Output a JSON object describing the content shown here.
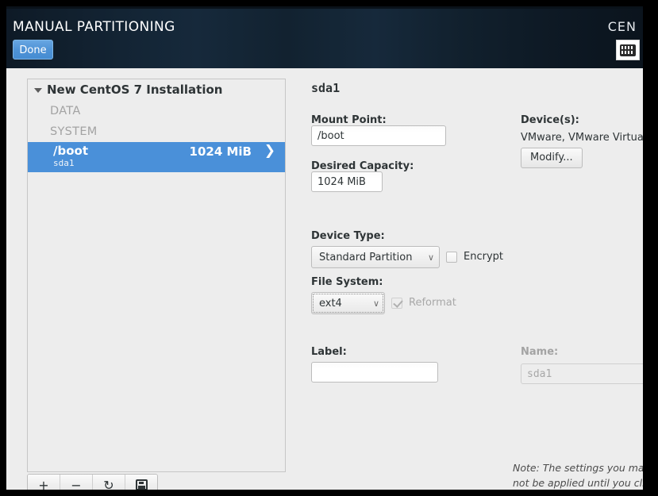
{
  "header": {
    "title": "MANUAL PARTITIONING",
    "done_label": "Done",
    "brand": "CEN",
    "keyboard_icon": "keyboard-icon"
  },
  "sidebar": {
    "group_title": "New CentOS 7 Installation",
    "sections": [
      {
        "label": "DATA"
      },
      {
        "label": "SYSTEM"
      }
    ],
    "rows": [
      {
        "mount": "/boot",
        "device": "sda1",
        "size": "1024 MiB",
        "chevron": "❯",
        "selected": true
      }
    ],
    "toolbar": {
      "add_label": "+",
      "remove_label": "−",
      "refresh_label": "↻",
      "storage_icon": "disk-icon"
    }
  },
  "panel": {
    "title": "sda1",
    "mount_point": {
      "label": "Mount Point:",
      "value": "/boot"
    },
    "desired_capacity": {
      "label": "Desired Capacity:",
      "value": "1024 MiB"
    },
    "device_type": {
      "label": "Device Type:",
      "value": "Standard Partition",
      "arrow": "∨"
    },
    "encrypt": {
      "label": "Encrypt",
      "checked": false
    },
    "file_system": {
      "label": "File System:",
      "value": "ext4",
      "arrow": "∨"
    },
    "reformat": {
      "label": "Reformat",
      "checked": true,
      "disabled": true
    },
    "label_field": {
      "label": "Label:",
      "value": ""
    },
    "name_field": {
      "label": "Name:",
      "value": "sda1",
      "disabled": true
    },
    "devices": {
      "label": "Device(s):",
      "value": "VMware, VMware Virtual S",
      "modify_label": "Modify..."
    },
    "note": {
      "line1": "Note:  The settings you mak",
      "line2": "not be applied until you clic"
    }
  },
  "colors": {
    "selection_blue": "#4a90d9",
    "header_dark": "#132434",
    "page_bg": "#ededed",
    "text_dark": "#2e3436",
    "text_dim": "#a3a3a3"
  }
}
